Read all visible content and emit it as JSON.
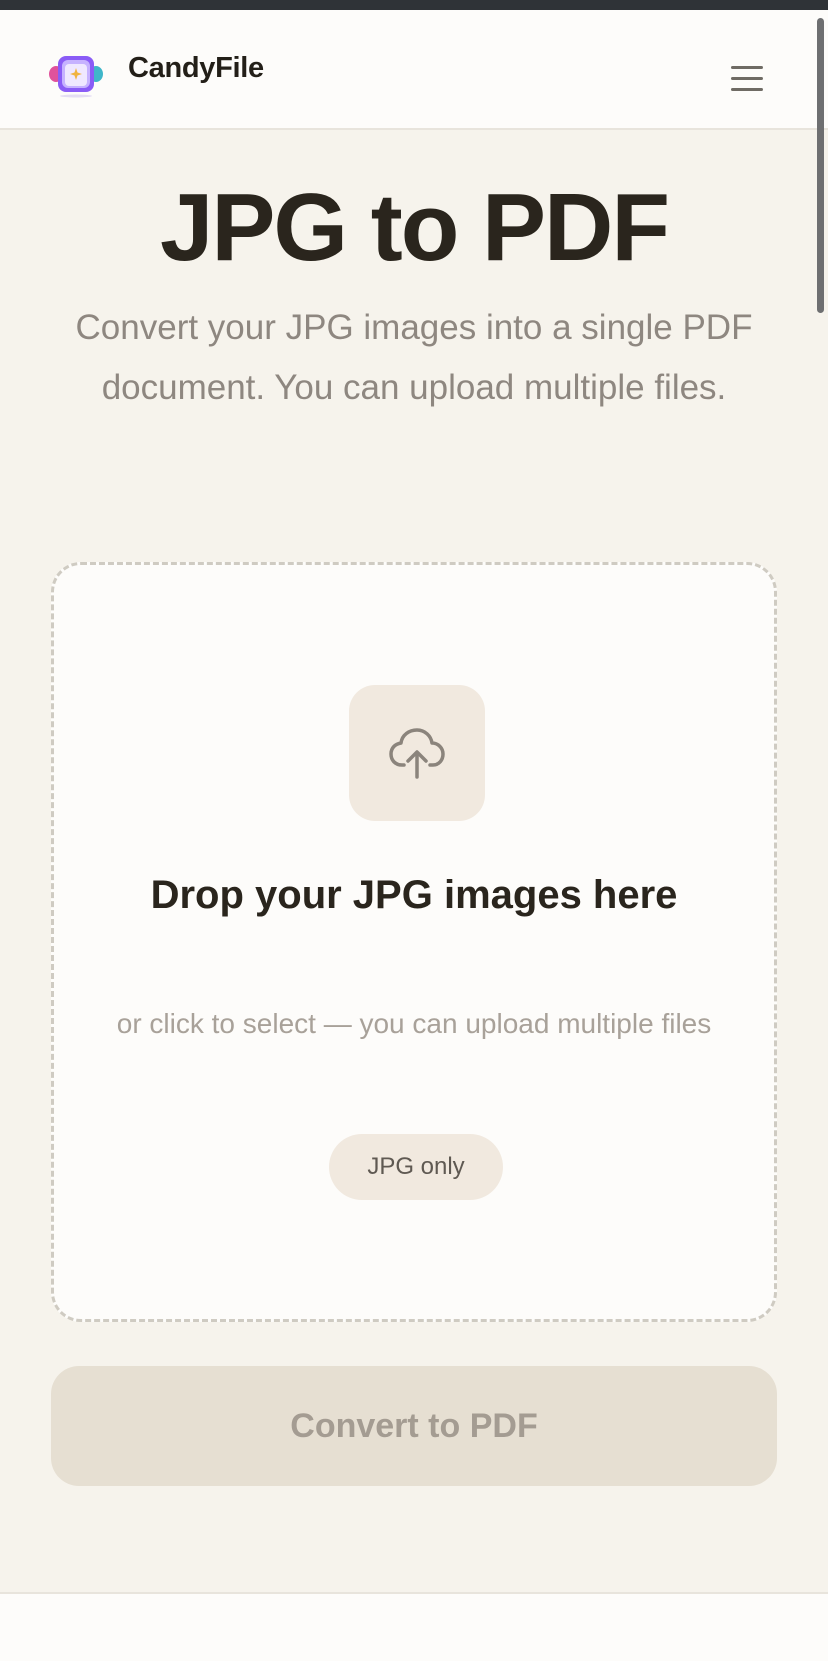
{
  "header": {
    "brand": "CandyFile",
    "logo_icon": "candyfile-logo-icon",
    "menu_icon": "hamburger-menu-icon"
  },
  "main": {
    "title": "JPG to PDF",
    "subtitle": "Convert your JPG images into a single PDF document. You can upload multiple files."
  },
  "dropzone": {
    "icon": "cloud-upload-icon",
    "title": "Drop your JPG images here",
    "subtitle": "or click to select — you can upload multiple files",
    "format_badge": "JPG only"
  },
  "actions": {
    "convert_label": "Convert to PDF",
    "convert_disabled": true
  },
  "colors": {
    "background": "#f6f3ec",
    "text_dark": "#2a251d",
    "text_muted": "#8e8780",
    "button_disabled_bg": "#e6dfd2",
    "accent_soft": "#f1e9df"
  }
}
